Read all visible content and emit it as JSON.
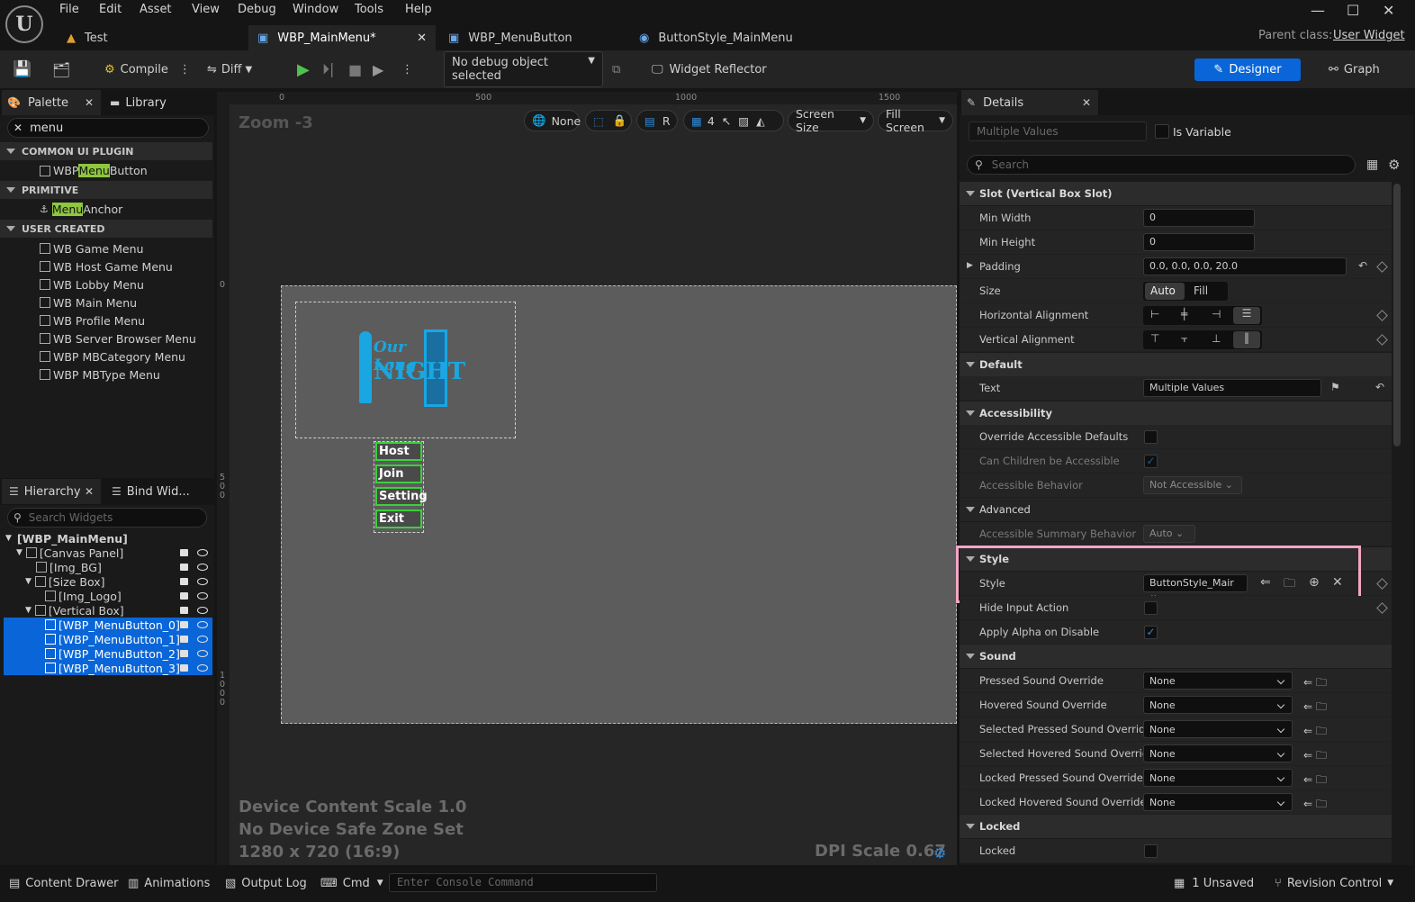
{
  "menu": [
    "File",
    "Edit",
    "Asset",
    "View",
    "Debug",
    "Window",
    "Tools",
    "Help"
  ],
  "tabs": [
    "Test",
    "WBP_MainMenu*",
    "WBP_MenuButton",
    "ButtonStyle_MainMenu"
  ],
  "parent_class": {
    "label": "Parent class:",
    "value": "User Widget"
  },
  "toolbar": {
    "compile": "Compile",
    "diff": "Diff",
    "debug_object": "No debug object selected",
    "reflector": "Widget Reflector",
    "designer": "Designer",
    "graph": "Graph"
  },
  "palette": {
    "tab": "Palette",
    "library_tab": "Library",
    "search_value": "menu",
    "sections": [
      {
        "title": "COMMON UI PLUGIN",
        "items": [
          {
            "pre": "WBP ",
            "hl": "Menu",
            "post": "Button"
          }
        ]
      },
      {
        "title": "PRIMITIVE",
        "items": [
          {
            "pre": "",
            "hl": "Menu",
            "post": "Anchor"
          }
        ]
      },
      {
        "title": "USER CREATED",
        "items": [
          {
            "pre": "WB Game Menu"
          },
          {
            "pre": "WB Host Game Menu"
          },
          {
            "pre": "WB Lobby Menu"
          },
          {
            "pre": "WB Main Menu"
          },
          {
            "pre": "WB Profile Menu"
          },
          {
            "pre": "WB Server Browser Menu"
          },
          {
            "pre": "WBP MBCategory Menu"
          },
          {
            "pre": "WBP MBType Menu"
          }
        ]
      }
    ]
  },
  "hierarchy": {
    "tab": "Hierarchy",
    "bind_tab": "Bind Wid...",
    "search_placeholder": "Search Widgets",
    "items": [
      "[WBP_MainMenu]",
      "[Canvas Panel]",
      "[Img_BG]",
      "[Size Box]",
      "[Img_Logo]",
      "[Vertical Box]",
      "[WBP_MenuButton_0]",
      "[WBP_MenuButton_1]",
      "[WBP_MenuButton_2]",
      "[WBP_MenuButton_3]"
    ]
  },
  "viewport": {
    "zoom": "Zoom -3",
    "ruler_x": [
      "0",
      "500",
      "1000",
      "1500"
    ],
    "ruler_y": [
      "0",
      "5\n0\n0",
      "1\n0\n0\n0"
    ],
    "none": "None",
    "r": "R",
    "grid": "4",
    "screen_size": "Screen Size",
    "fill_screen": "Fill Screen",
    "logo_line1": "Our Long",
    "logo_line2": "NIGHT",
    "buttons": [
      "Host",
      "Join",
      "Setting",
      "Exit"
    ],
    "info1": "Device Content Scale 1.0",
    "info2": "No Device Safe Zone Set",
    "info3": "1280 x 720 (16:9)",
    "dpi": "DPI Scale 0.67"
  },
  "details": {
    "tab": "Details",
    "name_value": "Multiple Values",
    "is_variable": "Is Variable",
    "search_placeholder": "Search",
    "slot_title": "Slot (Vertical Box Slot)",
    "min_width": {
      "label": "Min Width",
      "value": "0"
    },
    "min_height": {
      "label": "Min Height",
      "value": "0"
    },
    "padding": {
      "label": "Padding",
      "value": "0.0, 0.0, 0.0, 20.0"
    },
    "size": {
      "label": "Size",
      "auto": "Auto",
      "fill": "Fill"
    },
    "halign": "Horizontal Alignment",
    "valign": "Vertical Alignment",
    "default_title": "Default",
    "text": {
      "label": "Text",
      "value": "Multiple Values"
    },
    "access_title": "Accessibility",
    "override": "Override Accessible Defaults",
    "children": "Can Children be Accessible",
    "behavior": {
      "label": "Accessible Behavior",
      "value": "Not Accessible"
    },
    "advanced": "Advanced",
    "summary": {
      "label": "Accessible Summary Behavior",
      "value": "Auto"
    },
    "style_title": "Style",
    "style": {
      "label": "Style",
      "value": "ButtonStyle_Mair"
    },
    "hide_input": "Hide Input Action",
    "apply_alpha": "Apply Alpha on Disable",
    "sound_title": "Sound",
    "sounds": [
      {
        "label": "Pressed Sound Override",
        "value": "None"
      },
      {
        "label": "Hovered Sound Override",
        "value": "None"
      },
      {
        "label": "Selected Pressed Sound Override",
        "value": "None"
      },
      {
        "label": "Selected Hovered Sound Override",
        "value": "None"
      },
      {
        "label": "Locked Pressed Sound Override",
        "value": "None"
      },
      {
        "label": "Locked Hovered Sound Override",
        "value": "None"
      }
    ],
    "locked_title": "Locked",
    "locked": "Locked"
  },
  "status": {
    "content_drawer": "Content Drawer",
    "animations": "Animations",
    "output_log": "Output Log",
    "cmd": "Cmd",
    "console_placeholder": "Enter Console Command",
    "unsaved": "1 Unsaved",
    "revision": "Revision Control"
  },
  "colors": {
    "accent": "#0a66d8",
    "highlight": "#8ec63f",
    "logo": "#1aa6e0",
    "selection_box": "#f2a6c4",
    "button_border": "#3ad13a"
  }
}
